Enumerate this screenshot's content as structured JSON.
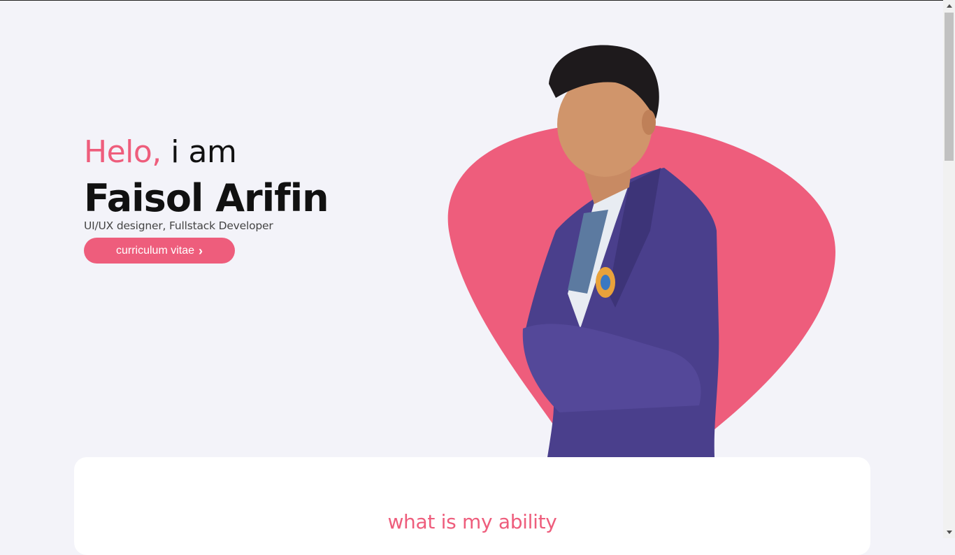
{
  "hero": {
    "greeting_accent": "Helo,",
    "greeting_rest": " i am",
    "name": "Faisol Arifin",
    "role": "UI/UX designer, Fullstack Developer",
    "cv_button_label": "curriculum vitae",
    "cv_button_icon": "chevron-right-icon"
  },
  "ability_section": {
    "title": "what is my ability"
  },
  "colors": {
    "accent": "#ee5d7c",
    "background": "#f3f3f9",
    "card": "#ffffff",
    "jacket": "#4a3f8c"
  }
}
